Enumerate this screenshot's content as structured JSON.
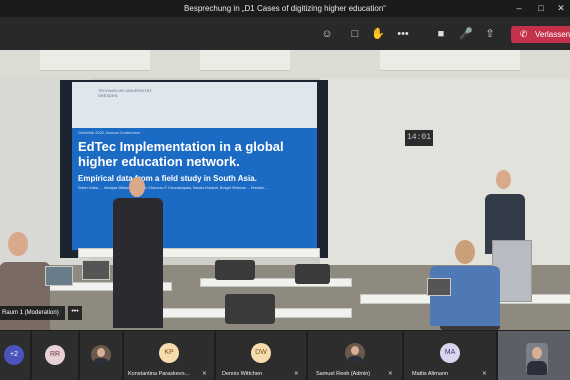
{
  "window": {
    "title": "Besprechung in „D1 Cases of digitizing higher education“",
    "controls": [
      "minimize-icon",
      "maximize-icon",
      "close-icon"
    ]
  },
  "toolbar": {
    "icons": [
      "participants-icon",
      "chat-icon",
      "raise-hand-icon",
      "more-icon",
      "camera-icon",
      "mic-off-icon",
      "share-icon"
    ],
    "more_label": "•••",
    "leave_label": "Verlassen",
    "leave_color": "#c4314b"
  },
  "slide": {
    "logo_text": "TECHNISCHE UNIVERSITÄT DRESDEN",
    "conference": "GeNeMe 2022, Annual Conference",
    "title": "EdTec Implementation in a global higher education network.",
    "subtitle": "Empirical data from a field study in South Asia.",
    "authors": "Dréan Jullius, ... Muntjula Wikramagalhanna, Sharoneu F. Karunanayaka, Sandra Hummel, Bridget Sheehan ... Dresden, ..."
  },
  "room": {
    "clock": "14:01"
  },
  "video_overlay": {
    "label": "Raum 1 (Moderation)",
    "more": "•••"
  },
  "participants": {
    "overflow": "+2",
    "tiles": [
      {
        "initials": "RR",
        "name": "",
        "color": "#e8d1d6"
      },
      {
        "initials": "",
        "name": "",
        "photo": true
      },
      {
        "initials": "KP",
        "name": "Konstantina Paraskevo...",
        "color": "#f6dcae"
      },
      {
        "initials": "DW",
        "name": "Dennis Wittchen",
        "color": "#f6dcae"
      },
      {
        "initials": "",
        "name": "Samuel Reeb (Admin)",
        "photo": true
      },
      {
        "initials": "MA",
        "name": "Mattis Altmann",
        "color": "#d8d6ee"
      }
    ]
  }
}
